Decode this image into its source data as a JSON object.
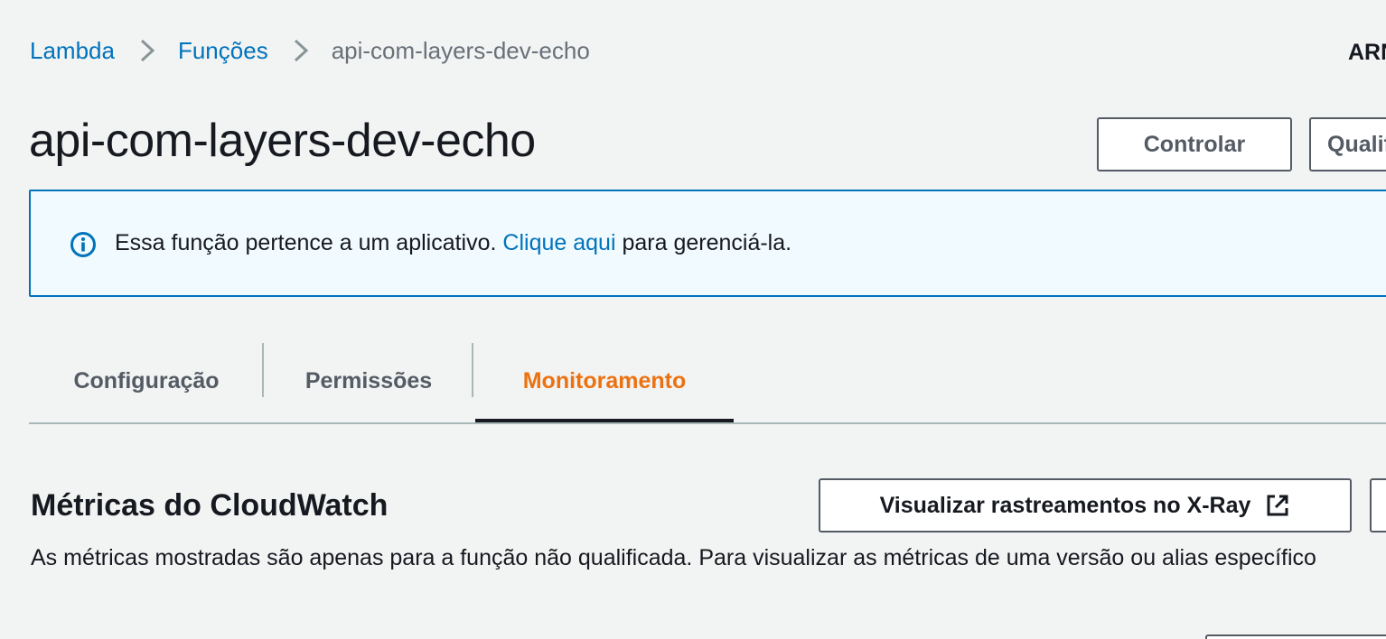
{
  "breadcrumb": {
    "items": [
      "Lambda",
      "Funções",
      "api-com-layers-dev-echo"
    ]
  },
  "header": {
    "arn_label": "ARN",
    "title": "api-com-layers-dev-echo",
    "throttle_label": "Controlar",
    "qualifiers_label": "Qualificadores"
  },
  "alert": {
    "icon": "info-icon",
    "text_before": "Essa função pertence a um aplicativo.",
    "link_text": "Clique aqui",
    "text_after": "para gerenciá-la."
  },
  "tabs": {
    "items": [
      {
        "label": "Configuração",
        "active": false
      },
      {
        "label": "Permissões",
        "active": false
      },
      {
        "label": "Monitoramento",
        "active": true
      }
    ],
    "active_color": "#ec7211"
  },
  "cloudwatch": {
    "title": "Métricas do CloudWatch",
    "xray_button_label": "Visualizar rastreamentos no X-Ray",
    "xray_icon": "external-link-icon",
    "description": "As métricas mostradas são apenas para a função não qualificada. Para visualizar as métricas de uma versão ou alias específico"
  },
  "colors": {
    "link": "#0073bb",
    "background": "#f2f3f3",
    "alert_background": "#f1faff",
    "text": "#16191f",
    "muted": "#545b64"
  }
}
